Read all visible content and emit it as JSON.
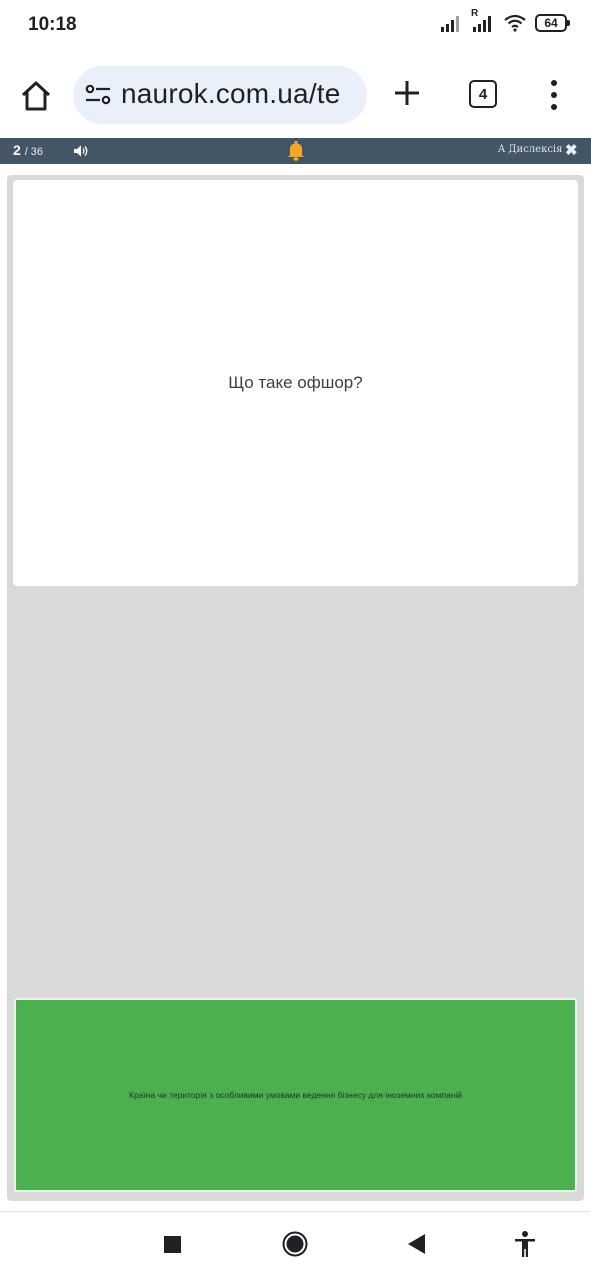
{
  "status_bar": {
    "time": "10:18",
    "roaming_label": "R",
    "battery": "64"
  },
  "browser": {
    "url": "naurok.com.ua/te",
    "tab_count": "4"
  },
  "quiz_header": {
    "current": "2",
    "total": "/ 36",
    "dyslexia_label": "A Дислексія",
    "close_label": "✖"
  },
  "question": {
    "text": "Що таке офшор?"
  },
  "answer": {
    "text": "Країна чи територія з особливими умовами ведення бізнесу для іноземних компаній",
    "color": "#4caf50"
  },
  "colors": {
    "header_bar": "#445566",
    "quiz_background": "#d9d9d9",
    "url_pill": "#eaf0fa"
  }
}
